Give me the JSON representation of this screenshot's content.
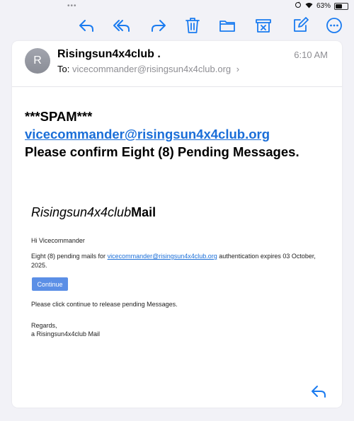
{
  "status_bar": {
    "dots": "•••",
    "battery_percent": "63%",
    "battery_level": 0.63
  },
  "toolbar": {
    "icons": [
      "reply-icon",
      "reply-all-icon",
      "forward-icon",
      "trash-icon",
      "folder-icon",
      "junk-icon",
      "compose-icon",
      "more-icon"
    ],
    "accent_color": "#1a7bf0"
  },
  "message": {
    "avatar_initial": "R",
    "sender": "Risingsun4x4club .",
    "time": "6:10 AM",
    "to_label": "To:",
    "to_address": "vicecommander@risingsun4x4club.org",
    "chevron": "›",
    "subject_line1": "***SPAM***",
    "subject_email": "vicecommander@risingsun4x4club.org",
    "subject_line3": "Please confirm Eight (8) Pending Messages."
  },
  "body": {
    "brand_italic": "Risingsun4x4club",
    "brand_bold": "Mail",
    "greeting": "Hi Vicecommander",
    "pending_prefix": "Eight (8) pending mails for ",
    "pending_link": "vicecommander@risingsun4x4club.org",
    "pending_suffix": " authentication expires 03 October, 2025.",
    "continue_button": "Continue",
    "instruction": "Please click continue to release pending Messages.",
    "regards": "Regards,",
    "signature": "a Risingsun4x4club Mail"
  }
}
